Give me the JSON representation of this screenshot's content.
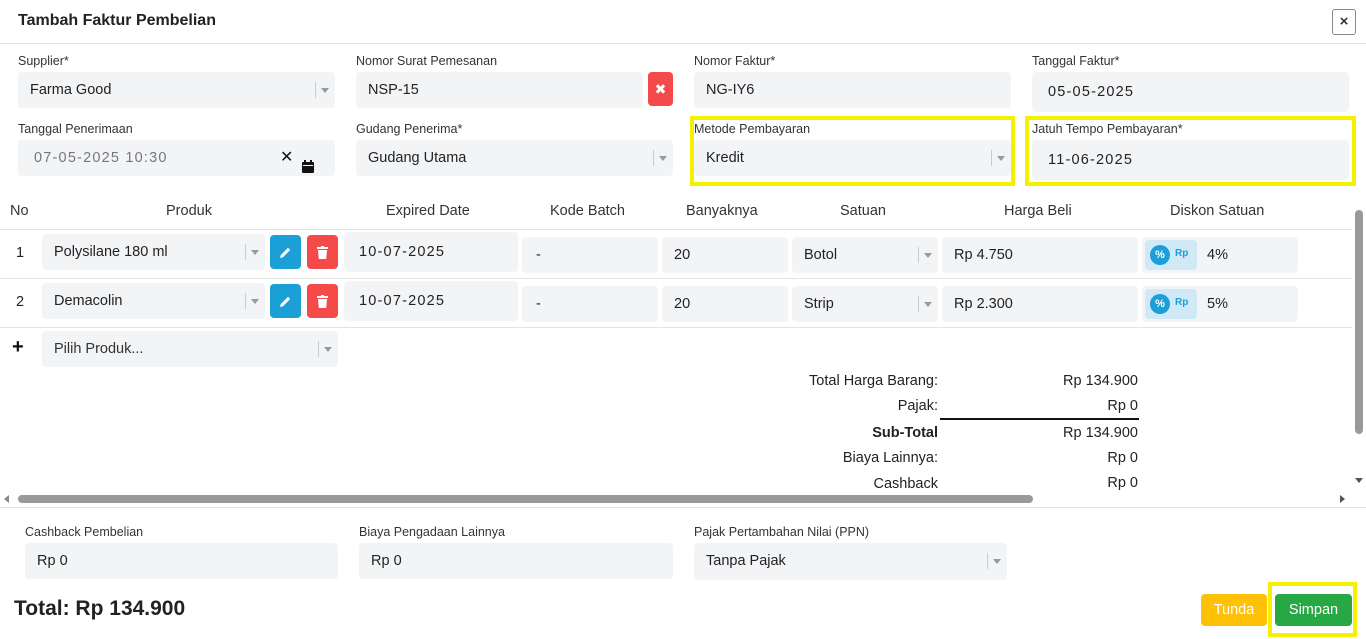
{
  "modal": {
    "title": "Tambah Faktur Pembelian",
    "close_label": "×"
  },
  "form": {
    "supplier": {
      "label": "Supplier*",
      "value": "Farma Good"
    },
    "nomor_surat": {
      "label": "Nomor Surat Pemesanan",
      "value": "NSP-15"
    },
    "nomor_faktur": {
      "label": "Nomor Faktur*",
      "value": "NG-IY6"
    },
    "tanggal_faktur": {
      "label": "Tanggal Faktur*",
      "value": "05-05-2025"
    },
    "tanggal_penerimaan": {
      "label": "Tanggal Penerimaan",
      "value": "07-05-2025 10:30"
    },
    "gudang": {
      "label": "Gudang Penerima*",
      "value": "Gudang Utama"
    },
    "metode": {
      "label": "Metode Pembayaran",
      "value": "Kredit"
    },
    "jatuh_tempo": {
      "label": "Jatuh Tempo Pembayaran*",
      "value": "11-06-2025"
    }
  },
  "table": {
    "headers": [
      "No",
      "Produk",
      "Expired Date",
      "Kode Batch",
      "Banyaknya",
      "Satuan",
      "Harga Beli",
      "Diskon Satuan"
    ],
    "rows": [
      {
        "no": "1",
        "produk": "Polysilane 180 ml",
        "expired": "10-07-2025",
        "batch": "-",
        "qty": "20",
        "satuan": "Botol",
        "harga": "Rp 4.750",
        "diskon": "4%"
      },
      {
        "no": "2",
        "produk": "Demacolin",
        "expired": "10-07-2025",
        "batch": "-",
        "qty": "20",
        "satuan": "Strip",
        "harga": "Rp 2.300",
        "diskon": "5%"
      }
    ],
    "add_product_placeholder": "Pilih Produk...",
    "discount_percent_symbol": "%",
    "discount_rp_symbol": "Rp"
  },
  "summary": {
    "total_harga_label": "Total Harga Barang:",
    "total_harga_value": "Rp 134.900",
    "pajak_label": "Pajak:",
    "pajak_value": "Rp 0",
    "subtotal_label": "Sub-Total",
    "subtotal_value": "Rp 134.900",
    "biaya_label": "Biaya Lainnya:",
    "biaya_value": "Rp 0",
    "cashback_label": "Cashback",
    "cashback_value": "Rp 0"
  },
  "footer": {
    "cashback_pembelian": {
      "label": "Cashback Pembelian",
      "value": "Rp 0"
    },
    "biaya_pengadaan": {
      "label": "Biaya Pengadaan Lainnya",
      "value": "Rp 0"
    },
    "ppn": {
      "label": "Pajak Pertambahan Nilai (PPN)",
      "value": "Tanpa Pajak"
    },
    "total_text": "Total: Rp 134.900",
    "tunda_label": "Tunda",
    "simpan_label": "Simpan"
  },
  "colors": {
    "highlight": "#f5ef00",
    "primary_blue": "#1a9fd6",
    "danger_red": "#f44a4a",
    "warning_yellow": "#ffc107",
    "success_green": "#28a745"
  }
}
